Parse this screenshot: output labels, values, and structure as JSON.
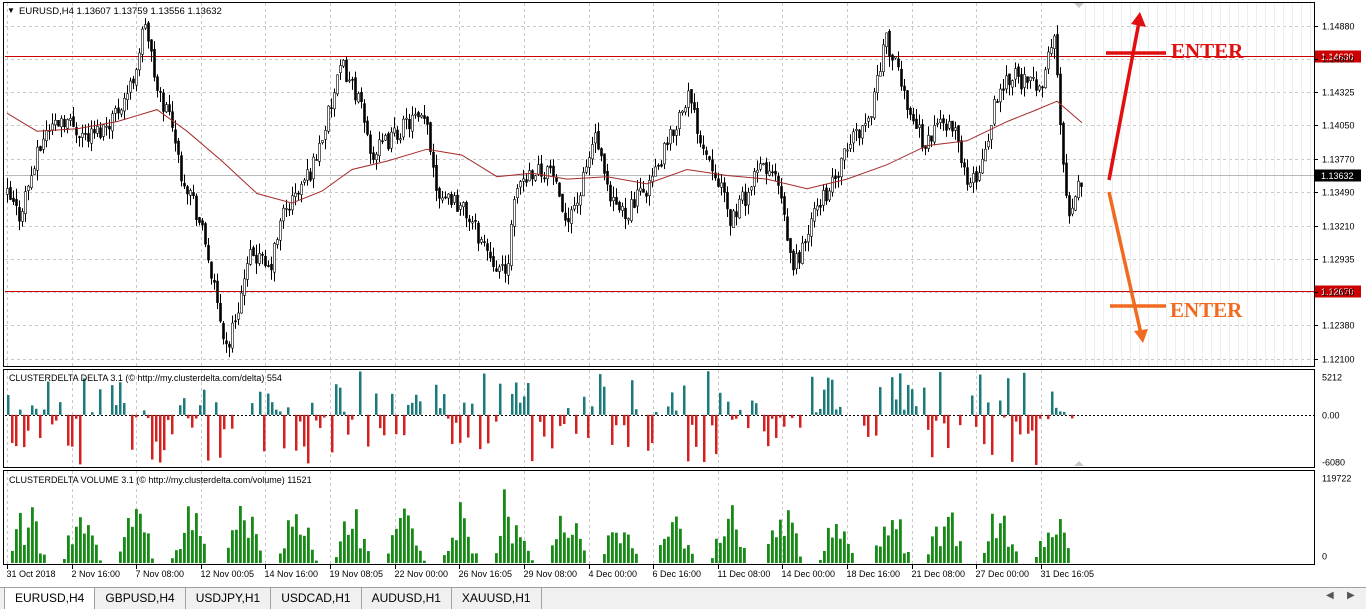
{
  "header": {
    "title": "EURUSD,H4  1.13607 1.13759 1.13556 1.13632"
  },
  "annotations": {
    "enter_top": "ENTER",
    "enter_bottom": "ENTER"
  },
  "tabs": [
    {
      "label": "EURUSD,H4",
      "active": true
    },
    {
      "label": "GBPUSD,H4",
      "active": false
    },
    {
      "label": "USDJPY,H1",
      "active": false
    },
    {
      "label": "USDCAD,H1",
      "active": false
    },
    {
      "label": "AUDUSD,H1",
      "active": false
    },
    {
      "label": "XAUUSD,H1",
      "active": false
    }
  ],
  "chart_data": [
    {
      "type": "candlestick",
      "title": "EURUSD,H4  1.13607 1.13759 1.13556 1.13632",
      "ylim": [
        1.1204,
        1.1507
      ],
      "y_ticks": [
        "1.14880",
        "1.14600",
        "1.14325",
        "1.14050",
        "1.13770",
        "1.13490",
        "1.13210",
        "1.12935",
        "1.12655",
        "1.12380",
        "1.12100"
      ],
      "y_tick_values": [
        1.1488,
        1.146,
        1.14325,
        1.1405,
        1.1377,
        1.1349,
        1.1321,
        1.12935,
        1.12655,
        1.1238,
        1.121
      ],
      "x_labels": [
        "31 Oct 2018",
        "2 Nov 16:00",
        "7 Nov 08:00",
        "12 Nov 00:05",
        "14 Nov 16:00",
        "19 Nov 08:05",
        "22 Nov 00:00",
        "26 Nov 16:05",
        "29 Nov 08:00",
        "4 Dec 00:00",
        "6 Dec 16:00",
        "11 Dec 08:00",
        "14 Dec 00:00",
        "18 Dec 16:00",
        "21 Dec 08:00",
        "27 Dec 00:00",
        "31 Dec 16:05"
      ],
      "levels": [
        {
          "label": "1.14630",
          "value": 1.1463,
          "color": "#cc0000"
        },
        {
          "label": "1.12670",
          "value": 1.1267,
          "color": "#cc0000"
        }
      ],
      "current_price": {
        "label": "1.13632",
        "value": 1.13632
      },
      "close_path": [
        [
          0,
          1.1346
        ],
        [
          12,
          1.133
        ],
        [
          22,
          1.1358
        ],
        [
          38,
          1.14
        ],
        [
          55,
          1.1412
        ],
        [
          80,
          1.1395
        ],
        [
          95,
          1.1402
        ],
        [
          110,
          1.1418
        ],
        [
          125,
          1.144
        ],
        [
          138,
          1.1492
        ],
        [
          150,
          1.1432
        ],
        [
          165,
          1.141
        ],
        [
          172,
          1.137
        ],
        [
          185,
          1.1345
        ],
        [
          200,
          1.13
        ],
        [
          210,
          1.1252
        ],
        [
          220,
          1.1218
        ],
        [
          232,
          1.1258
        ],
        [
          245,
          1.13
        ],
        [
          262,
          1.1282
        ],
        [
          276,
          1.1332
        ],
        [
          290,
          1.1348
        ],
        [
          305,
          1.137
        ],
        [
          320,
          1.141
        ],
        [
          335,
          1.1455
        ],
        [
          350,
          1.143
        ],
        [
          365,
          1.138
        ],
        [
          385,
          1.1395
        ],
        [
          405,
          1.141
        ],
        [
          420,
          1.1405
        ],
        [
          430,
          1.135
        ],
        [
          445,
          1.1345
        ],
        [
          460,
          1.133
        ],
        [
          472,
          1.1312
        ],
        [
          485,
          1.1295
        ],
        [
          498,
          1.1278
        ],
        [
          510,
          1.1355
        ],
        [
          525,
          1.1368
        ],
        [
          545,
          1.1368
        ],
        [
          555,
          1.1325
        ],
        [
          572,
          1.1345
        ],
        [
          588,
          1.1398
        ],
        [
          602,
          1.134
        ],
        [
          618,
          1.1332
        ],
        [
          635,
          1.1348
        ],
        [
          650,
          1.1368
        ],
        [
          665,
          1.1398
        ],
        [
          680,
          1.1432
        ],
        [
          695,
          1.139
        ],
        [
          710,
          1.1365
        ],
        [
          722,
          1.1325
        ],
        [
          740,
          1.1348
        ],
        [
          755,
          1.1372
        ],
        [
          770,
          1.1358
        ],
        [
          785,
          1.1285
        ],
        [
          798,
          1.1308
        ],
        [
          812,
          1.1342
        ],
        [
          828,
          1.1358
        ],
        [
          845,
          1.1395
        ],
        [
          862,
          1.141
        ],
        [
          878,
          1.1478
        ],
        [
          892,
          1.1445
        ],
        [
          905,
          1.1412
        ],
        [
          918,
          1.1388
        ],
        [
          935,
          1.1412
        ],
        [
          950,
          1.1395
        ],
        [
          962,
          1.135
        ],
        [
          975,
          1.1375
        ],
        [
          990,
          1.1432
        ],
        [
          1005,
          1.145
        ],
        [
          1020,
          1.1438
        ],
        [
          1035,
          1.1442
        ],
        [
          1048,
          1.1482
        ],
        [
          1055,
          1.1372
        ],
        [
          1062,
          1.1335
        ],
        [
          1075,
          1.1363
        ]
      ],
      "ma_path": [
        [
          0,
          1.1415
        ],
        [
          30,
          1.14
        ],
        [
          70,
          1.1402
        ],
        [
          110,
          1.1408
        ],
        [
          150,
          1.1418
        ],
        [
          180,
          1.14
        ],
        [
          215,
          1.1375
        ],
        [
          250,
          1.1348
        ],
        [
          285,
          1.134
        ],
        [
          315,
          1.135
        ],
        [
          345,
          1.1368
        ],
        [
          380,
          1.1375
        ],
        [
          420,
          1.1385
        ],
        [
          455,
          1.138
        ],
        [
          490,
          1.1362
        ],
        [
          525,
          1.1365
        ],
        [
          560,
          1.136
        ],
        [
          600,
          1.1362
        ],
        [
          640,
          1.1356
        ],
        [
          680,
          1.1368
        ],
        [
          720,
          1.1363
        ],
        [
          760,
          1.136
        ],
        [
          800,
          1.1352
        ],
        [
          840,
          1.136
        ],
        [
          880,
          1.1372
        ],
        [
          920,
          1.1388
        ],
        [
          960,
          1.1392
        ],
        [
          1000,
          1.1408
        ],
        [
          1030,
          1.1418
        ],
        [
          1050,
          1.1425
        ],
        [
          1075,
          1.1407
        ]
      ]
    },
    {
      "type": "bar",
      "title": "CLUSTERDELTA DELTA 3.1 (© http://my.clusterdelta.com/delta) 554",
      "ylim": [
        -6080,
        5212
      ],
      "y_ticks": [
        "5212",
        "0.00",
        "-6080"
      ],
      "y_tick_values": [
        5212,
        0,
        -6080
      ],
      "seed": 7
    },
    {
      "type": "bar",
      "title": "CLUSTERDELTA VOLUME 3.1 (© http://my.clusterdelta.com/volume) 11521",
      "ylim": [
        0,
        119722
      ],
      "y_ticks": [
        "119722",
        "0"
      ],
      "y_tick_values": [
        119722,
        0
      ],
      "seed": 13
    }
  ],
  "colors": {
    "bull": "#000000",
    "bear": "#000000",
    "ma": "#a52a2a",
    "level": "#cc0000",
    "delta_pos": "#1b7a7a",
    "delta_neg": "#d42020",
    "volume": "#168a16",
    "enter_top": "#e01010",
    "enter_bottom": "#f06a20"
  }
}
